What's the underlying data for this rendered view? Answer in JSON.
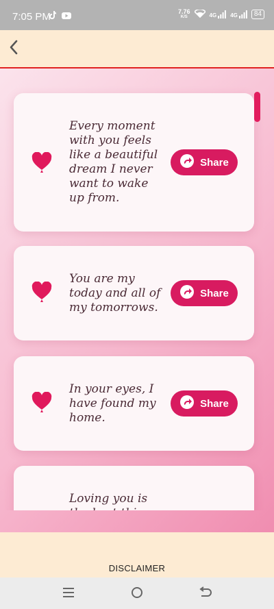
{
  "status_bar": {
    "time": "7:05 PM",
    "net_speed_value": "7.76",
    "net_speed_unit": "K/S",
    "network_1": "4G",
    "network_2": "4G",
    "battery": "84"
  },
  "header": {
    "back_icon": "chevron-left-icon"
  },
  "quotes": [
    {
      "text": "Every moment with you feels like a beautiful dream I never want to wake up from.",
      "share_label": "Share"
    },
    {
      "text": "You are my today and all of my tomorrows.",
      "share_label": "Share"
    },
    {
      "text": "In your eyes, I have found my home.",
      "share_label": "Share"
    },
    {
      "text": "Loving you is the best thing"
    }
  ],
  "footer": {
    "disclaimer": "DISCLAIMER"
  },
  "colors": {
    "accent": "#d81b60",
    "header_bg": "#fdebd3",
    "header_border": "#e02020"
  }
}
